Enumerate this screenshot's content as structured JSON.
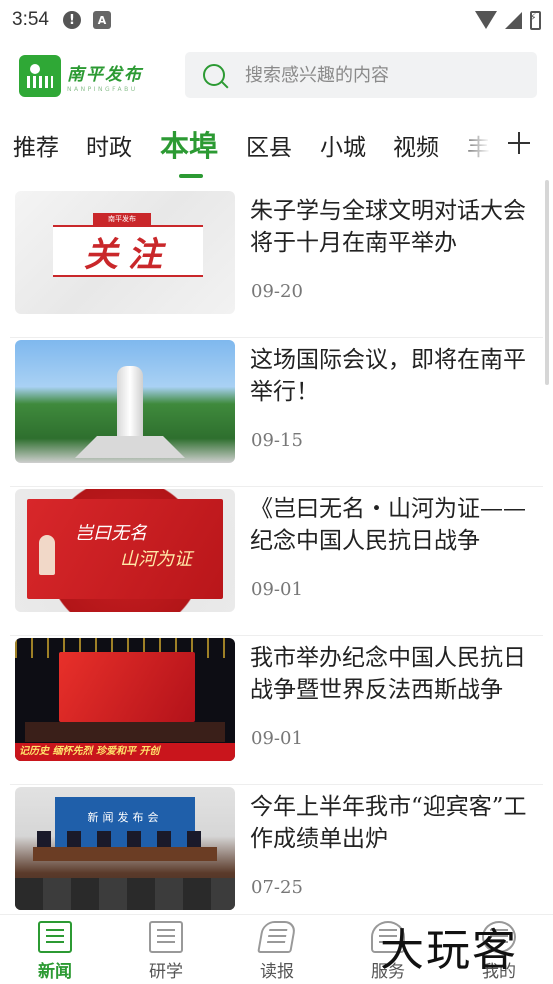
{
  "status_bar": {
    "time": "3:54",
    "left_icons": [
      "alert-icon",
      "a-icon"
    ],
    "right_icons": [
      "wifi-icon",
      "signal-icon",
      "battery-charging-icon"
    ],
    "alert_glyph": "!",
    "a_glyph": "A"
  },
  "header": {
    "logo_cn": "南平发布",
    "logo_en": "NANPINGFABU",
    "search_placeholder": "搜索感兴趣的内容"
  },
  "tabs": [
    {
      "label": "推荐",
      "active": false
    },
    {
      "label": "时政",
      "active": false
    },
    {
      "label": "本埠",
      "active": true
    },
    {
      "label": "区县",
      "active": false
    },
    {
      "label": "小城",
      "active": false
    },
    {
      "label": "视频",
      "active": false
    },
    {
      "label": "丰",
      "active": false
    }
  ],
  "articles": [
    {
      "title": "朱子学与全球文明对话大会将于十月在南平举办",
      "date": "09-20",
      "thumb": {
        "tag": "南平发布",
        "banner": "关注"
      }
    },
    {
      "title": "这场国际会议，即将在南平举行！",
      "date": "09-15",
      "thumb": {}
    },
    {
      "title": "《岂曰无名・山河为证——纪念中国人民抗日战争",
      "date": "09-01",
      "thumb": {
        "line1": "岂曰无名",
        "line2": "山河为证"
      }
    },
    {
      "title": "我市举办纪念中国人民抗日战争暨世界反法西斯战争",
      "date": "09-01",
      "thumb": {
        "strip": "记历史 缅怀先烈 珍爱和平 开创"
      }
    },
    {
      "title": "今年上半年我市“迎宾客”工作成绩单出炉",
      "date": "07-25",
      "thumb": {
        "wall": "新闻发布会"
      }
    }
  ],
  "bottom_nav": [
    {
      "label": "新闻",
      "icon": "newspaper-icon",
      "active": true
    },
    {
      "label": "研学",
      "icon": "book-icon",
      "active": false
    },
    {
      "label": "读报",
      "icon": "reading-icon",
      "active": false
    },
    {
      "label": "服务",
      "icon": "service-icon",
      "active": false
    },
    {
      "label": "我的",
      "icon": "profile-icon",
      "active": false
    }
  ],
  "watermark": "大玩客",
  "colors": {
    "accent": "#2c9a33",
    "logo_bg": "#2fa836",
    "text": "#222222",
    "date": "#777777"
  }
}
